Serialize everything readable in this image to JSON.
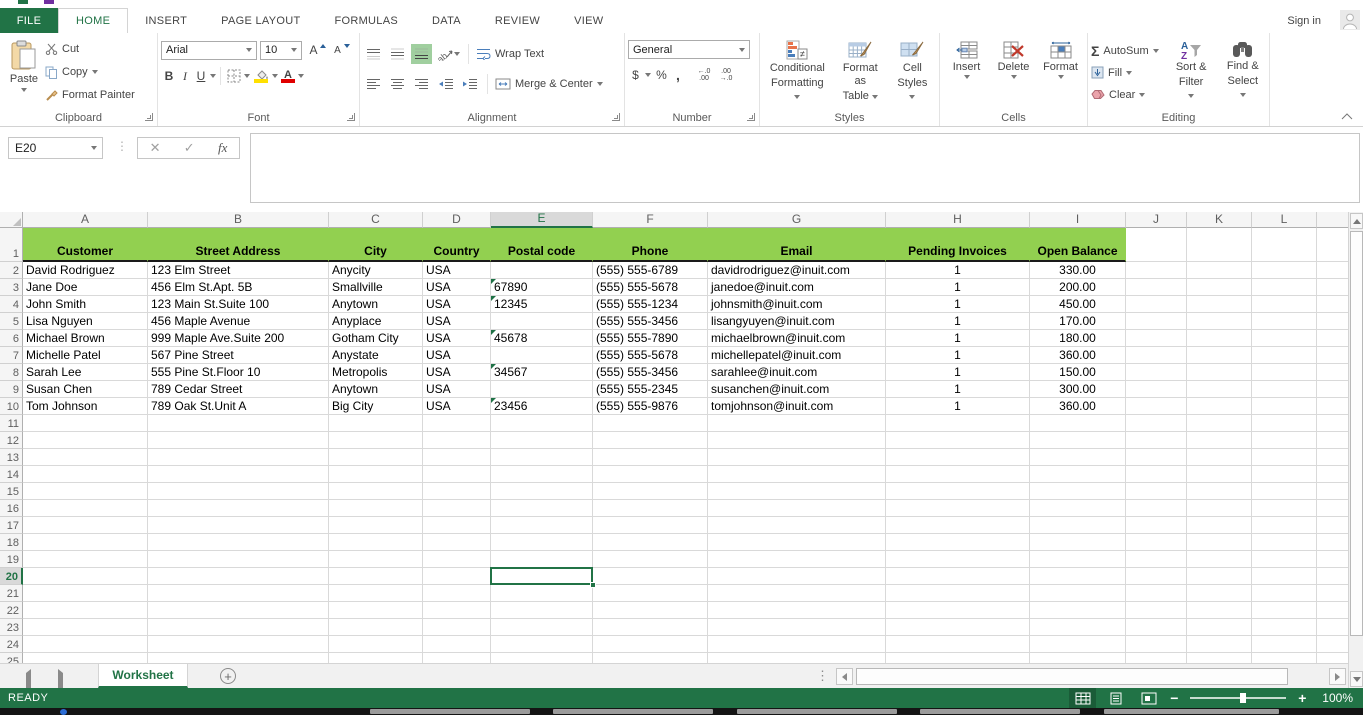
{
  "window": {
    "sign_in": "Sign in"
  },
  "ribbon_tabs": {
    "file": "FILE",
    "home": "HOME",
    "insert": "INSERT",
    "page_layout": "PAGE LAYOUT",
    "formulas": "FORMULAS",
    "data": "DATA",
    "review": "REVIEW",
    "view": "VIEW"
  },
  "clipboard": {
    "label": "Clipboard",
    "paste": "Paste",
    "cut": "Cut",
    "copy": "Copy",
    "format_painter": "Format Painter"
  },
  "font": {
    "label": "Font",
    "family": "Arial",
    "size": "10"
  },
  "alignment": {
    "label": "Alignment",
    "wrap_text": "Wrap Text",
    "merge_center": "Merge & Center"
  },
  "number": {
    "label": "Number",
    "format": "General"
  },
  "styles": {
    "label": "Styles",
    "cf1": "Conditional",
    "cf2": "Formatting",
    "fat1": "Format as",
    "fat2": "Table",
    "cs1": "Cell",
    "cs2": "Styles"
  },
  "cells": {
    "label": "Cells",
    "insert": "Insert",
    "delete": "Delete",
    "format": "Format"
  },
  "editing": {
    "label": "Editing",
    "autosum": "AutoSum",
    "fill": "Fill",
    "clear": "Clear",
    "sf1": "Sort &",
    "sf2": "Filter",
    "fs1": "Find &",
    "fs2": "Select"
  },
  "glyphs": {
    "bold": "B",
    "italic": "I",
    "underline": "U",
    "dollar": "$",
    "percent": "%",
    "comma": ",",
    "sigma": "Σ",
    "fx": "fx",
    "check": "✓",
    "cancel": "✕",
    "sort_a": "A",
    "sort_z": "Z",
    "grow": "A",
    "shrink": "A",
    "orient": "ab",
    "neq": "≠",
    "inc_top": "←.0",
    "inc_bot": ".00",
    "dec_top": ".00",
    "dec_bot": "→.0",
    "plus": "+",
    "minus": "−"
  },
  "formula_bar": {
    "name_box": "E20",
    "value": ""
  },
  "sheet": {
    "column_letters": [
      "A",
      "B",
      "C",
      "D",
      "E",
      "F",
      "G",
      "H",
      "I",
      "J",
      "K",
      "L"
    ],
    "selected_column": "E",
    "selected_row": 20,
    "selected_cell": "E20",
    "first_row": 1,
    "visible_rows": 25,
    "header_fill": "#92d050",
    "header_row": {
      "row": 1,
      "values": [
        "Customer",
        "Street Address",
        "City",
        "Country",
        "Postal code",
        "Phone",
        "Email",
        "Pending Invoices",
        "Open Balance"
      ]
    },
    "rows": [
      [
        "David Rodriguez",
        "123 Elm Street",
        "Anycity",
        "USA",
        "",
        "(555) 555-6789",
        "davidrodriguez@inuit.com",
        "1",
        "330.00"
      ],
      [
        "Jane Doe",
        "456 Elm St.Apt. 5B",
        "Smallville",
        "USA",
        "67890",
        "(555) 555-5678",
        "janedoe@inuit.com",
        "1",
        "200.00"
      ],
      [
        "John Smith",
        "123 Main St.Suite 100",
        "Anytown",
        "USA",
        "12345",
        "(555) 555-1234",
        "johnsmith@inuit.com",
        "1",
        "450.00"
      ],
      [
        "Lisa Nguyen",
        "456 Maple Avenue",
        "Anyplace",
        "USA",
        "",
        "(555) 555-3456",
        "lisangyuyen@inuit.com",
        "1",
        "170.00"
      ],
      [
        "Michael Brown",
        "999 Maple Ave.Suite 200",
        "Gotham City",
        "USA",
        "45678",
        "(555) 555-7890",
        "michaelbrown@inuit.com",
        "1",
        "180.00"
      ],
      [
        "Michelle Patel",
        "567 Pine Street",
        "Anystate",
        "USA",
        "",
        "(555) 555-5678",
        "michellepatel@inuit.com",
        "1",
        "360.00"
      ],
      [
        "Sarah Lee",
        "555 Pine St.Floor 10",
        "Metropolis",
        "USA",
        "34567",
        "(555) 555-3456",
        "sarahlee@inuit.com",
        "1",
        "150.00"
      ],
      [
        "Susan Chen",
        "789 Cedar Street",
        "Anytown",
        "USA",
        "",
        "(555) 555-2345",
        "susanchen@inuit.com",
        "1",
        "300.00"
      ],
      [
        "Tom Johnson",
        "789 Oak St.Unit A",
        "Big City",
        "USA",
        "23456",
        "(555) 555-9876",
        "tomjohnson@inuit.com",
        "1",
        "360.00"
      ]
    ],
    "postal_flag_rows": [
      3,
      4,
      6,
      8,
      10
    ]
  },
  "sheet_tab_bar": {
    "active_tab": "Worksheet"
  },
  "status_bar": {
    "mode": "READY",
    "zoom": "100%"
  }
}
